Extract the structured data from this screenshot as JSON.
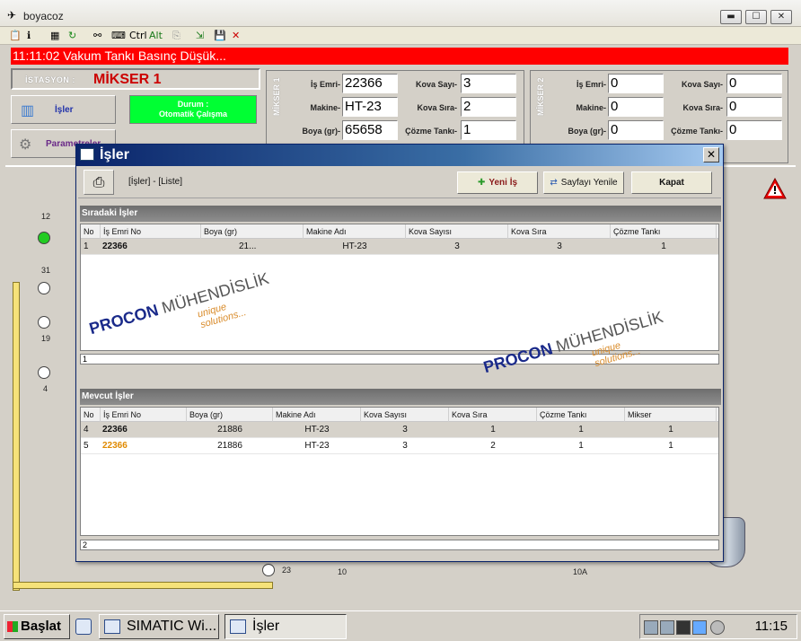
{
  "window": {
    "title": "boyacoz",
    "buttons": {
      "minimize": "▬",
      "maximize": "☐",
      "close": "✕"
    }
  },
  "toolbar": {
    "ctrl_label": "Ctrl",
    "alt_label": "Alt"
  },
  "alarm": {
    "text": "11:11:02 Vakum Tankı Basınç Düşük..."
  },
  "station": {
    "label": "İSTASYON :",
    "value": "MİKSER 1"
  },
  "nav": {
    "jobs_label": "İşler",
    "params_label": "Parametreler"
  },
  "status": {
    "line1": "Durum :",
    "line2": "Otomatik Çalışma",
    "color": "#00ff33"
  },
  "mixer1": {
    "side_label": "MİKSER 1",
    "labels": {
      "order": "İş Emri-",
      "machine": "Makine-",
      "paint": "Boya (gr)-",
      "bucket_count": "Kova Sayı-",
      "bucket_seq": "Kova Sıra-",
      "tank": "Çözme Tankı-"
    },
    "values": {
      "order": "22366",
      "machine": "HT-23",
      "paint": "65658",
      "bucket_count": "3",
      "bucket_seq": "2",
      "tank": "1"
    }
  },
  "mixer2": {
    "side_label": "MİKSER 2",
    "labels": {
      "order": "İş Emri-",
      "machine": "Makine-",
      "paint": "Boya (gr)-",
      "bucket_count": "Kova Sayı-",
      "bucket_seq": "Kova Sıra-",
      "tank": "Çözme Tankı-"
    },
    "values": {
      "order": "0",
      "machine": "0",
      "paint": "0",
      "bucket_count": "0",
      "bucket_seq": "0",
      "tank": "0"
    }
  },
  "schematic": {
    "numbers": [
      "12",
      "31",
      "19",
      "4",
      "23",
      "10",
      "10A"
    ]
  },
  "dialog": {
    "title": "İşler",
    "breadcrumb": "[İşler] - [Liste]",
    "buttons": {
      "new": "Yeni İş",
      "refresh": "Sayfayı Yenile",
      "close": "Kapat"
    },
    "queue": {
      "title": "Sıradaki İşler",
      "columns": [
        "No",
        "İş Emri No",
        "Boya (gr)",
        "Makine Adı",
        "Kova Sayısı",
        "Kova Sıra",
        "Çözme Tankı"
      ],
      "rows": [
        {
          "no": "1",
          "order": "22366",
          "paint": "21...",
          "machine": "HT-23",
          "count": "3",
          "seq": "3",
          "tank": "1"
        }
      ],
      "footer": "1"
    },
    "current": {
      "title": "Mevcut İşler",
      "columns": [
        "No",
        "İş Emri No",
        "Boya (gr)",
        "Makine Adı",
        "Kova Sayısı",
        "Kova Sıra",
        "Çözme Tankı",
        "Mikser"
      ],
      "rows": [
        {
          "no": "4",
          "order": "22366",
          "paint": "21886",
          "machine": "HT-23",
          "count": "3",
          "seq": "1",
          "tank": "1",
          "mixer": "1",
          "highlight": false
        },
        {
          "no": "5",
          "order": "22366",
          "paint": "21886",
          "machine": "HT-23",
          "count": "3",
          "seq": "2",
          "tank": "1",
          "mixer": "1",
          "highlight": true
        }
      ],
      "footer": "2"
    },
    "watermark": {
      "brand": "PROCON",
      "suffix": "MÜHENDİSLİK",
      "tagline": "unique solutions..."
    }
  },
  "taskbar": {
    "start": "Başlat",
    "tasks": [
      "SIMATIC Wi...",
      "İşler"
    ],
    "clock": "11:15"
  }
}
